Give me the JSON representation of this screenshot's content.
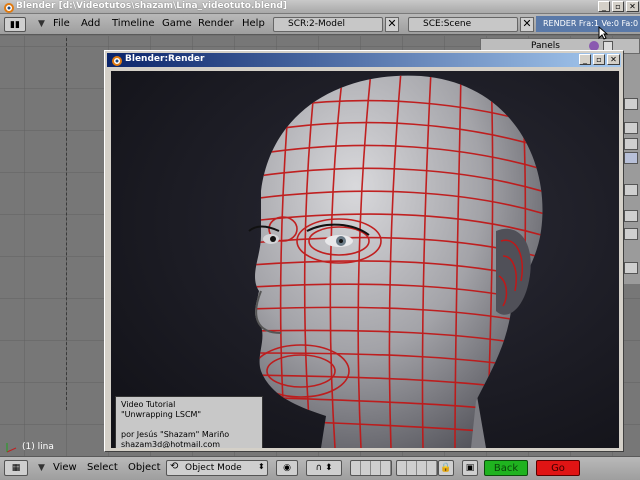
{
  "app": {
    "title": "Blender [d:\\Videotutos\\shazam\\Lina_videotuto.blend]"
  },
  "top_menu": [
    "File",
    "Add",
    "Timeline",
    "Game",
    "Render",
    "Help"
  ],
  "screen_field": "SCR:2-Model",
  "scene_field": "SCE:Scene",
  "render_info": "RENDER  Fra:1  Ve:0 Fa:0",
  "panels_label": "Panels",
  "viewport": {
    "object_label": "(1) lina"
  },
  "render_window": {
    "title": "Blender:Render",
    "caption": {
      "line1": "Video Tutorial",
      "line2": "\"Unwrapping LSCM\"",
      "line3": "por Jesús \"Shazam\" Mariño",
      "line4": "shazam3d@hotmail.com"
    }
  },
  "bottom_menu": [
    "View",
    "Select",
    "Object"
  ],
  "mode_select": "Object Mode",
  "buttons": {
    "back": "Back",
    "go": "Go"
  },
  "icons": [
    "blender-logo-icon",
    "minimize-icon",
    "maximize-icon",
    "close-icon",
    "editor-type-icon",
    "chevron-down-icon",
    "viewport-shading-icon",
    "snap-icon",
    "layer-grid-icon",
    "lock-icon",
    "render-icon"
  ],
  "colors": {
    "back_button": "#1fb31f",
    "go_button": "#e01414",
    "render_info_bg": "#5a79a8",
    "wire_red": "#c01818"
  }
}
